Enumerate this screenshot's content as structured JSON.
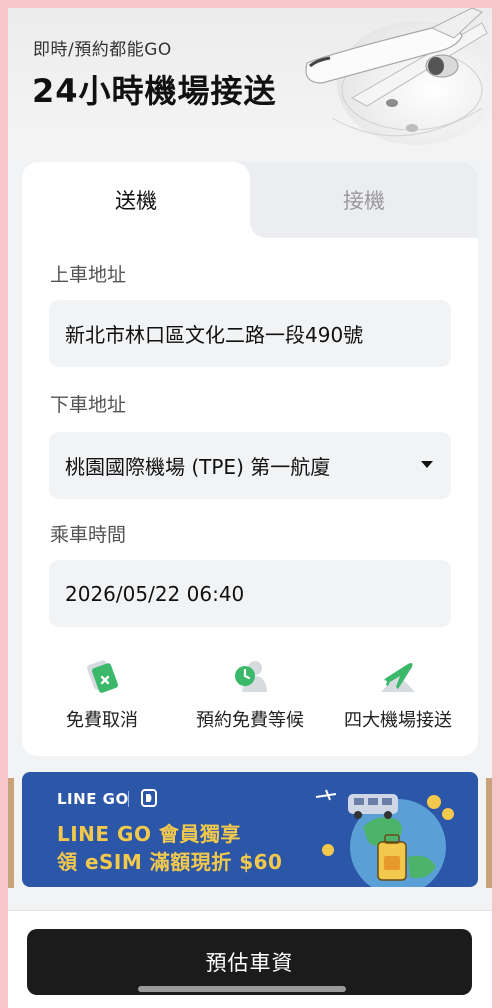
{
  "header": {
    "subtitle": "即時/預約都能GO",
    "title": "24小時機場接送"
  },
  "tabs": [
    {
      "label": "送機",
      "active": true
    },
    {
      "label": "接機",
      "active": false
    }
  ],
  "form": {
    "pickup": {
      "label": "上車地址",
      "value": "新北市林口區文化二路一段490號"
    },
    "dropoff": {
      "label": "下車地址",
      "value": "桃園國際機場 (TPE) 第一航廈"
    },
    "time": {
      "label": "乘車時間",
      "value": "2026/05/22 06:40"
    }
  },
  "features": [
    {
      "label": "免費取消",
      "icon": "free-cancel-ticket-icon"
    },
    {
      "label": "預約免費等候",
      "icon": "clock-person-icon"
    },
    {
      "label": "四大機場接送",
      "icon": "plane-icon"
    }
  ],
  "banner": {
    "brand": "LINE GO",
    "line1": "LINE GO 會員獨享",
    "line2": "領 eSIM 滿額現折 $60"
  },
  "cta": {
    "label": "預估車資"
  },
  "colors": {
    "accent_green": "#3cb86b",
    "cta_bg": "#1b1b1b",
    "banner_bg": "#2c56a8",
    "banner_text": "#f2c94c"
  }
}
